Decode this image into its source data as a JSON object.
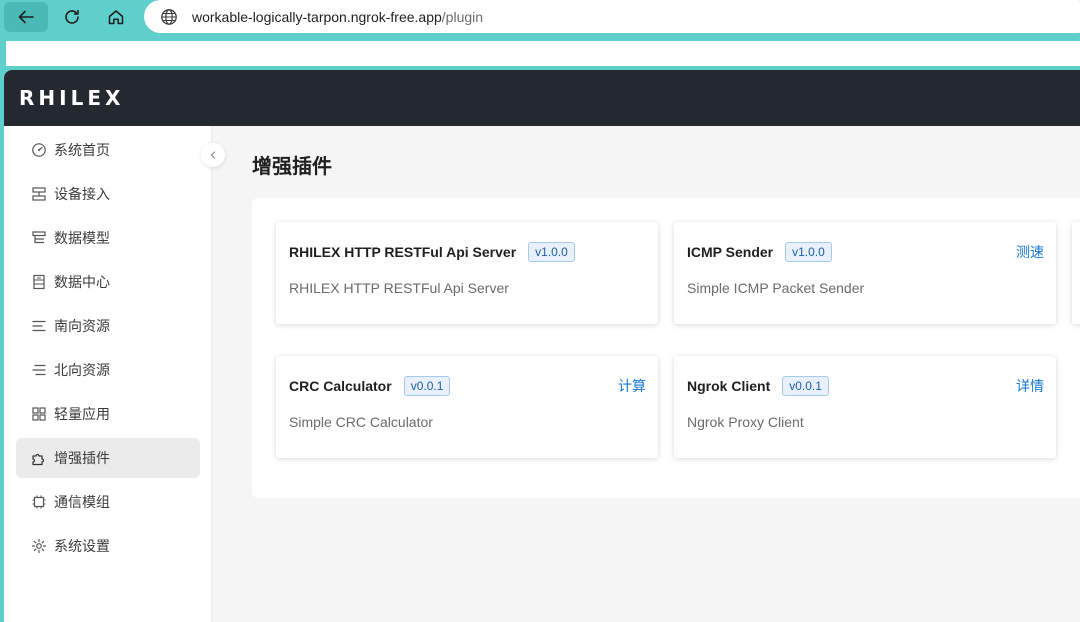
{
  "browser": {
    "url_host": "workable-logically-tarpon.ngrok-free.app",
    "url_path": "/plugin"
  },
  "app": {
    "logo": "RHILEX"
  },
  "sidebar": {
    "items": [
      {
        "label": "系统首页",
        "icon": "dashboard-icon"
      },
      {
        "label": "设备接入",
        "icon": "device-icon"
      },
      {
        "label": "数据模型",
        "icon": "data-model-icon"
      },
      {
        "label": "数据中心",
        "icon": "data-center-icon"
      },
      {
        "label": "南向资源",
        "icon": "southbound-icon"
      },
      {
        "label": "北向资源",
        "icon": "northbound-icon"
      },
      {
        "label": "轻量应用",
        "icon": "apps-icon"
      },
      {
        "label": "增强插件",
        "icon": "plugin-icon",
        "active": true
      },
      {
        "label": "通信模组",
        "icon": "chip-icon"
      },
      {
        "label": "系统设置",
        "icon": "settings-icon"
      }
    ]
  },
  "main": {
    "title": "增强插件",
    "cards": [
      {
        "name": "RHILEX HTTP RESTFul Api Server",
        "version": "v1.0.0",
        "description": "RHILEX HTTP RESTFul Api Server",
        "action": ""
      },
      {
        "name": "ICMP Sender",
        "version": "v1.0.0",
        "description": "Simple ICMP Packet Sender",
        "action": "测速"
      },
      {
        "name": "CRC Calculator",
        "version": "v0.0.1",
        "description": "Simple CRC Calculator",
        "action": "计算"
      },
      {
        "name": "Ngrok Client",
        "version": "v0.0.1",
        "description": "Ngrok Proxy Client",
        "action": "详情"
      }
    ]
  },
  "colors": {
    "browser_chrome": "#5fcfcc",
    "topbar": "#23292e",
    "link": "#1677d2",
    "version_tag": "#1e5fa8"
  }
}
